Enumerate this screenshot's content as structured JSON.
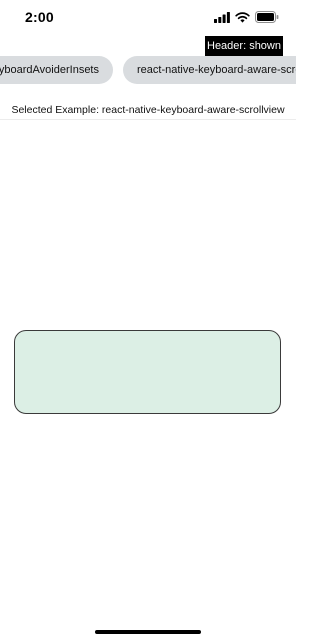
{
  "status_bar": {
    "time": "2:00",
    "icons": [
      "signal-icon",
      "wifi-icon",
      "battery-icon"
    ]
  },
  "header": {
    "badge_label": "Header: shown",
    "badge_color": "#000000"
  },
  "examples": {
    "chips": [
      {
        "label": "KeyboardAvoiderInsets"
      },
      {
        "label": "react-native-keyboard-aware-scrollview"
      }
    ],
    "chip_color": "#d9dcdf"
  },
  "selected_example": "Selected Example: react-native-keyboard-aware-scrollview",
  "text_input": {
    "value": "",
    "background": "#dcefe5"
  }
}
